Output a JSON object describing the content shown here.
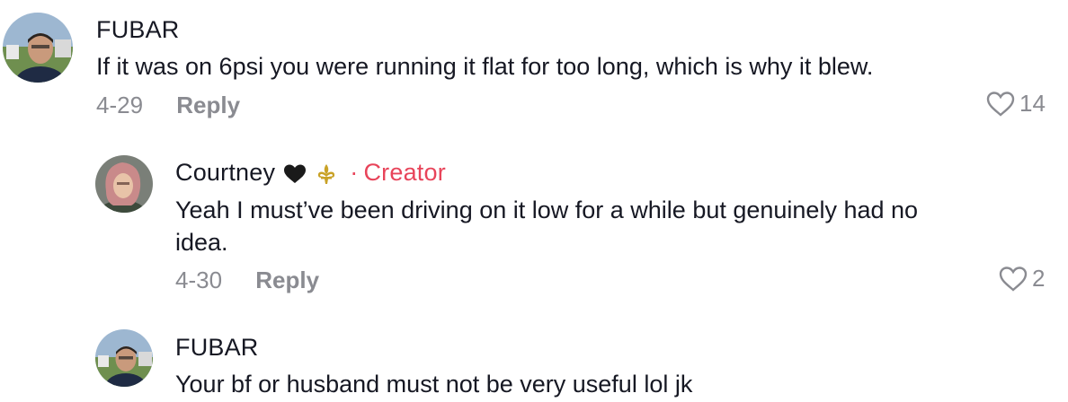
{
  "comments": [
    {
      "username": "FUBAR",
      "text": "If it was on 6psi you were running it flat for too long, which is why it blew.",
      "date": "4-29",
      "reply_label": "Reply",
      "likes": "14"
    },
    {
      "username": "Courtney",
      "badge_separator": "·",
      "badge": "Creator",
      "text_line1": "Yeah I must’ve been driving on it low for a while but genuinely had no",
      "text_line2": "idea.",
      "date": "4-30",
      "reply_label": "Reply",
      "likes": "2"
    },
    {
      "username": "FUBAR",
      "text": "Your bf or husband must not be very useful lol jk"
    }
  ],
  "icons": {
    "like": "heart-outline-icon",
    "emoji1": "black-heart-emoji",
    "emoji2": "fleur-de-lis-emoji"
  },
  "colors": {
    "text": "#161823",
    "muted": "#8a8b91",
    "creator": "#e8445a"
  }
}
